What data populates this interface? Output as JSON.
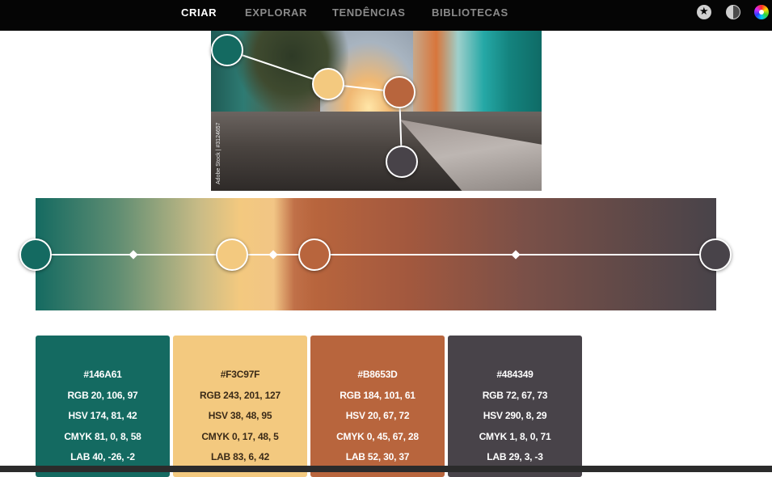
{
  "nav": {
    "items": [
      "CRIAR",
      "EXPLORAR",
      "TENDÊNCIAS",
      "BIBLIOTECAS"
    ],
    "active": "CRIAR",
    "icons": [
      "star-icon",
      "contrast-icon",
      "color-wheel-icon"
    ]
  },
  "photo": {
    "credit": "Adobe Stock | #3124657"
  },
  "colors": {
    "c1": "#146A61",
    "c2": "#F3C97F",
    "c3": "#B8653D",
    "c4": "#484349"
  },
  "swatches": [
    {
      "hex": "#146A61",
      "rgb": "RGB 20, 106, 97",
      "hsv": "HSV 174, 81, 42",
      "cmyk": "CMYK 81, 0, 8, 58",
      "lab": "LAB 40, -26, -2"
    },
    {
      "hex": "#F3C97F",
      "rgb": "RGB 243, 201, 127",
      "hsv": "HSV 38, 48, 95",
      "cmyk": "CMYK 0, 17, 48, 5",
      "lab": "LAB 83, 6, 42"
    },
    {
      "hex": "#B8653D",
      "rgb": "RGB 184, 101, 61",
      "hsv": "HSV 20, 67, 72",
      "cmyk": "CMYK 0, 45, 67, 28",
      "lab": "LAB 52, 30, 37"
    },
    {
      "hex": "#484349",
      "rgb": "RGB 72, 67, 73",
      "hsv": "HSV 290, 8, 29",
      "cmyk": "CMYK 1, 8, 0, 71",
      "lab": "LAB 29, 3, -3"
    }
  ]
}
